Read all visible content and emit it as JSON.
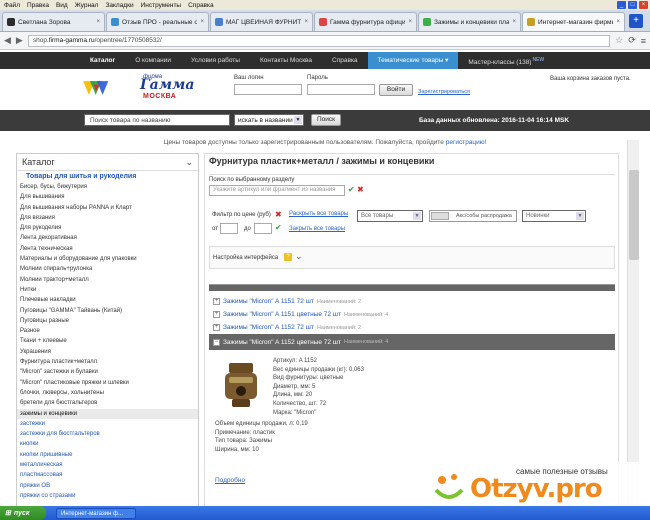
{
  "menubar": {
    "items": [
      "Файл",
      "Правка",
      "Вид",
      "Журнал",
      "Закладки",
      "Инструменты",
      "Справка"
    ]
  },
  "tabs": [
    {
      "label": "Светлана Зорова",
      "color": "#2b2b2b"
    },
    {
      "label": "Отзыв ПРО - реальные от...",
      "color": "#3a8fd0"
    },
    {
      "label": "МАГ ЦВЕЙНАЯ ФУРНИТУР...",
      "color": "#4a7fd0"
    },
    {
      "label": "Гамма фурнитура официал...",
      "color": "#d44"
    },
    {
      "label": "Зажимы и концевики плас...",
      "color": "#3ab04a"
    },
    {
      "label": "Интернет-магазин фирмы ...",
      "color": "#c6a020"
    }
  ],
  "address": {
    "prefix": "shop.",
    "domain": "firma-gamma.ru",
    "path": "/opentree/1770508532/"
  },
  "nav": {
    "items": [
      "Каталог",
      "О компании",
      "Условия работы",
      "Контакты Москва",
      "Справка",
      "Тематические товары",
      "Мастер-классы (138)"
    ],
    "new_badge": "NEW"
  },
  "logo": {
    "small": "фирма",
    "big": "Гамма",
    "city": "МОСКВА"
  },
  "login": {
    "login_label": "Ваш логин",
    "password_label": "Пароль",
    "button": "Войти",
    "register": "Зарегистрироваться"
  },
  "cart": {
    "text": "Ваша корзина заказов пуста."
  },
  "search": {
    "placeholder": "Поиск товара по названию",
    "mode": "искать в названии",
    "button": "Поиск",
    "db_updated": "База данных обновлена: 2016-11-04 16:14 MSK"
  },
  "notice": {
    "text": "Цены товаров доступны только зарегистрированным пользователям. Пожалуйста, пройдите",
    "link": "регистрацию!"
  },
  "sidebar": {
    "title": "Каталог",
    "section": "Товары для шитья и рукоделия",
    "items": [
      "Бисер, бусы, бижутерия",
      "Для вышивания",
      "Для вышивания наборы PANNA и Кларт",
      "Для вязания",
      "Для рукоделия",
      "Лента декоративная",
      "Лента техническая",
      "Материалы и оборудование для упаковки",
      "Молнии спираль+рулонка",
      "Молнии трактор+металл",
      "Нитки",
      "Плечевые накладки",
      "Пуговицы \"GAMMA\" Тайвань (Китай)",
      "Пуговицы разные",
      "Разное",
      "Ткани + клеевые",
      "Украшения",
      "Фурнитура пластик+металл",
      "\"Micron\" застежки и булавки",
      "\"Micron\" пластиковые пряжки и шлевки",
      "блочки, люверсы, хольнитены",
      "бретели для бюстгальтеров",
      "зажимы и концевики",
      "застежки",
      "застежки для бюстгальтеров",
      "кнопки",
      "кнопки пришивные",
      "металлическая",
      "пластмассовая",
      "пряжки ОВ",
      "пряжки со стразами"
    ]
  },
  "main": {
    "title": "Фурнитура пластик+металл / зажимы и концевики",
    "section_search_label": "Поиск по выбранному разделу",
    "section_search_placeholder": "Укажите артикул или фрагмент из названия",
    "price_filter_label": "Фильтр по цене (руб)",
    "show_all": "Раскрыть все товары",
    "collapse_all": "Закрыть все товары",
    "from": "от",
    "to": "до",
    "all_goods": "Все товары",
    "sale": "Акс/собы распродажа",
    "sort": "Новинки",
    "settings": "Настройка интерфейса",
    "products": [
      {
        "name": "Зажимы \"Micron\" A 1151 72 шт",
        "count": "Наименований: 2"
      },
      {
        "name": "Зажимы \"Micron\" A 1151 цветные 72 шт",
        "count": "Наименований: 4"
      },
      {
        "name": "Зажимы \"Micron\" A 1152 72 шт",
        "count": "Наименований: 2"
      },
      {
        "name": "Зажимы \"Micron\" A 1152 цветные 72 шт",
        "count": "Наименований: 4"
      }
    ],
    "detail": {
      "attrs": [
        "Артикул: A 1152",
        "Вес единицы продажи (кг): 0,063",
        "Вид фурнитуры: цветные",
        "Диаметр, мм: 5",
        "Длина, мм: 20",
        "Количество, шт: 72",
        "Марка: \"Micron\""
      ],
      "attrs2": [
        "Объем единицы продажи, л: 0,19",
        "Примечание: пластик",
        "Тип товара: Зажимы",
        "Ширина, мм: 10"
      ],
      "more": "Подробно"
    }
  },
  "taskbar": {
    "start": "пуск",
    "item": "Интернет-магазин ф..."
  },
  "watermark": {
    "slogan": "самые полезные отзывы",
    "brand": "Otzyv.pro"
  }
}
